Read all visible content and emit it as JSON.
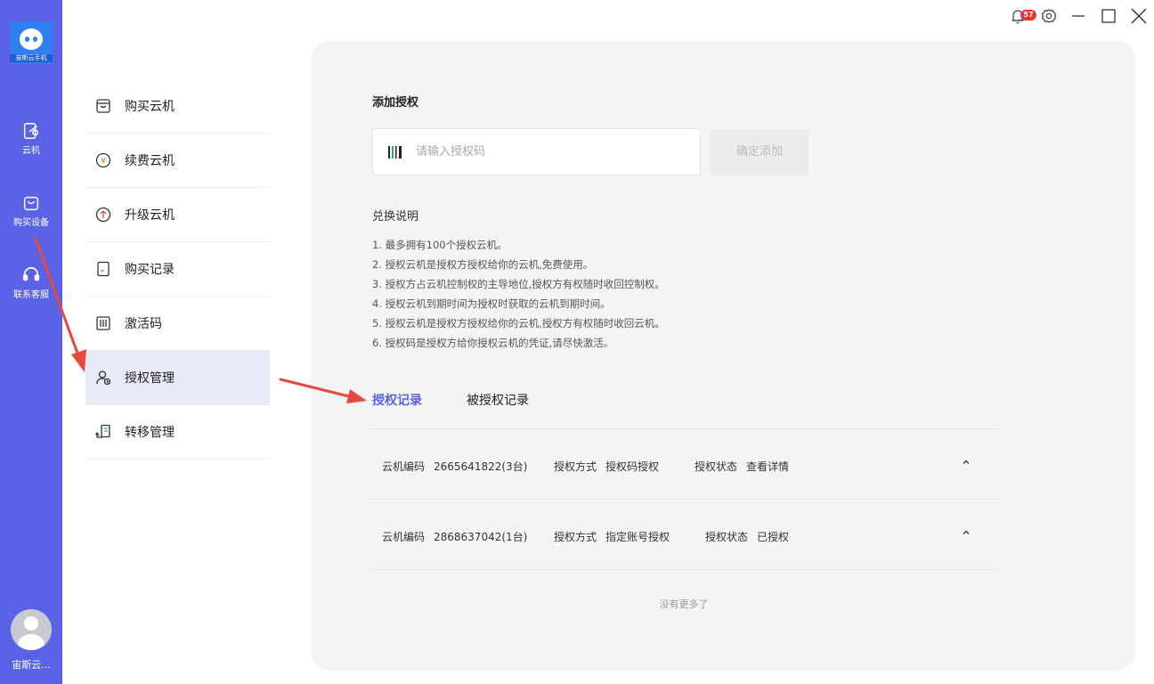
{
  "app": {
    "logo_text": "宙斯云手机",
    "user_name": "宙斯云..."
  },
  "rail": [
    {
      "label": "云机",
      "icon": "cloud-phone-icon"
    },
    {
      "label": "购买设备",
      "icon": "shopping-bag-icon"
    },
    {
      "label": "联系客服",
      "icon": "headset-icon"
    }
  ],
  "titlebar": {
    "notification_count": "57",
    "icons": [
      "bell-icon",
      "gear-icon",
      "minimize-icon",
      "maximize-icon",
      "close-icon"
    ]
  },
  "menu": [
    {
      "label": "购买云机",
      "icon": "cart-icon"
    },
    {
      "label": "续费云机",
      "icon": "yen-coin-icon"
    },
    {
      "label": "升级云机",
      "icon": "arrow-up-circle-icon"
    },
    {
      "label": "购买记录",
      "icon": "receipt-icon"
    },
    {
      "label": "激活码",
      "icon": "barcode-icon"
    },
    {
      "label": "授权管理",
      "icon": "user-auth-icon",
      "active": true
    },
    {
      "label": "转移管理",
      "icon": "transfer-icon"
    }
  ],
  "auth": {
    "title": "添加授权",
    "input_placeholder": "请输入授权码",
    "confirm_label": "确定添加",
    "rules_title": "兑换说明",
    "rules": [
      "1. 最多拥有100个授权云机。",
      "2. 授权云机是授权方授权给你的云机,免费使用。",
      "3. 授权方占云机控制权的主导地位,授权方有权随时收回控制权。",
      "4. 授权云机到期时间为授权时获取的云机到期时间。",
      "5. 授权云机是授权方授权给你的云机,授权方有权随时收回云机。",
      "6. 授权码是授权方给你授权云机的凭证,请尽快激活。"
    ]
  },
  "tabs": [
    {
      "label": "授权记录",
      "active": true
    },
    {
      "label": "被授权记录",
      "active": false
    }
  ],
  "records": [
    {
      "code_label": "云机编码",
      "code_value": "2665641822(3台)",
      "method_label": "授权方式",
      "method_value": "授权码授权",
      "status_label": "授权状态",
      "status_value": "查看详情"
    },
    {
      "code_label": "云机编码",
      "code_value": "2868637042(1台)",
      "method_label": "授权方式",
      "method_value": "指定账号授权",
      "status_label": "授权状态",
      "status_value": "已授权"
    }
  ],
  "no_more_text": "没有更多了",
  "colors": {
    "rail": "#5a63e6",
    "active_tab": "#5563e0",
    "active_menu_bg": "#e8e9f6",
    "arrow": "#e8493f",
    "badge": "#e33333"
  }
}
